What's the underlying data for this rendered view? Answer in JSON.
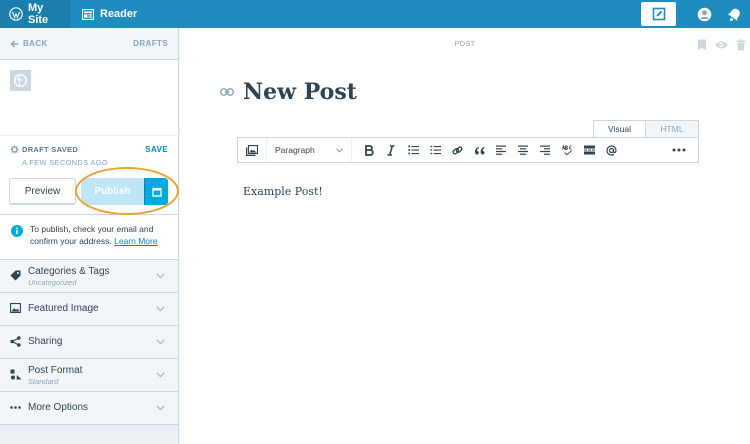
{
  "masterbar": {
    "my_site": "My Site",
    "reader": "Reader"
  },
  "sidebar": {
    "back": "BACK",
    "drafts": "DRAFTS",
    "draft_saved": "DRAFT SAVED",
    "saved_ago": "A FEW SECONDS AGO",
    "save": "SAVE",
    "preview": "Preview",
    "publish": "Publish",
    "notice_text": "To publish, check your email and confirm your address.",
    "notice_link": "Learn More",
    "accordion": [
      {
        "label": "Categories & Tags",
        "sub": "Uncategorized",
        "icon": "tag-icon"
      },
      {
        "label": "Featured Image",
        "sub": "",
        "icon": "image-icon"
      },
      {
        "label": "Sharing",
        "sub": "",
        "icon": "share-icon"
      },
      {
        "label": "Post Format",
        "sub": "Standard",
        "icon": "post-format-icon"
      },
      {
        "label": "More Options",
        "sub": "",
        "icon": "ellipsis-icon"
      }
    ]
  },
  "editor": {
    "header_label": "POST",
    "title": "New Post",
    "tabs": [
      "Visual",
      "HTML"
    ],
    "format_select": "Paragraph",
    "content": "Example Post!"
  },
  "colors": {
    "masterbar": "#1e8cbe",
    "accent": "#0087be",
    "publish_disabled": "#bfe6f6",
    "highlight_ring": "#f0a035"
  }
}
